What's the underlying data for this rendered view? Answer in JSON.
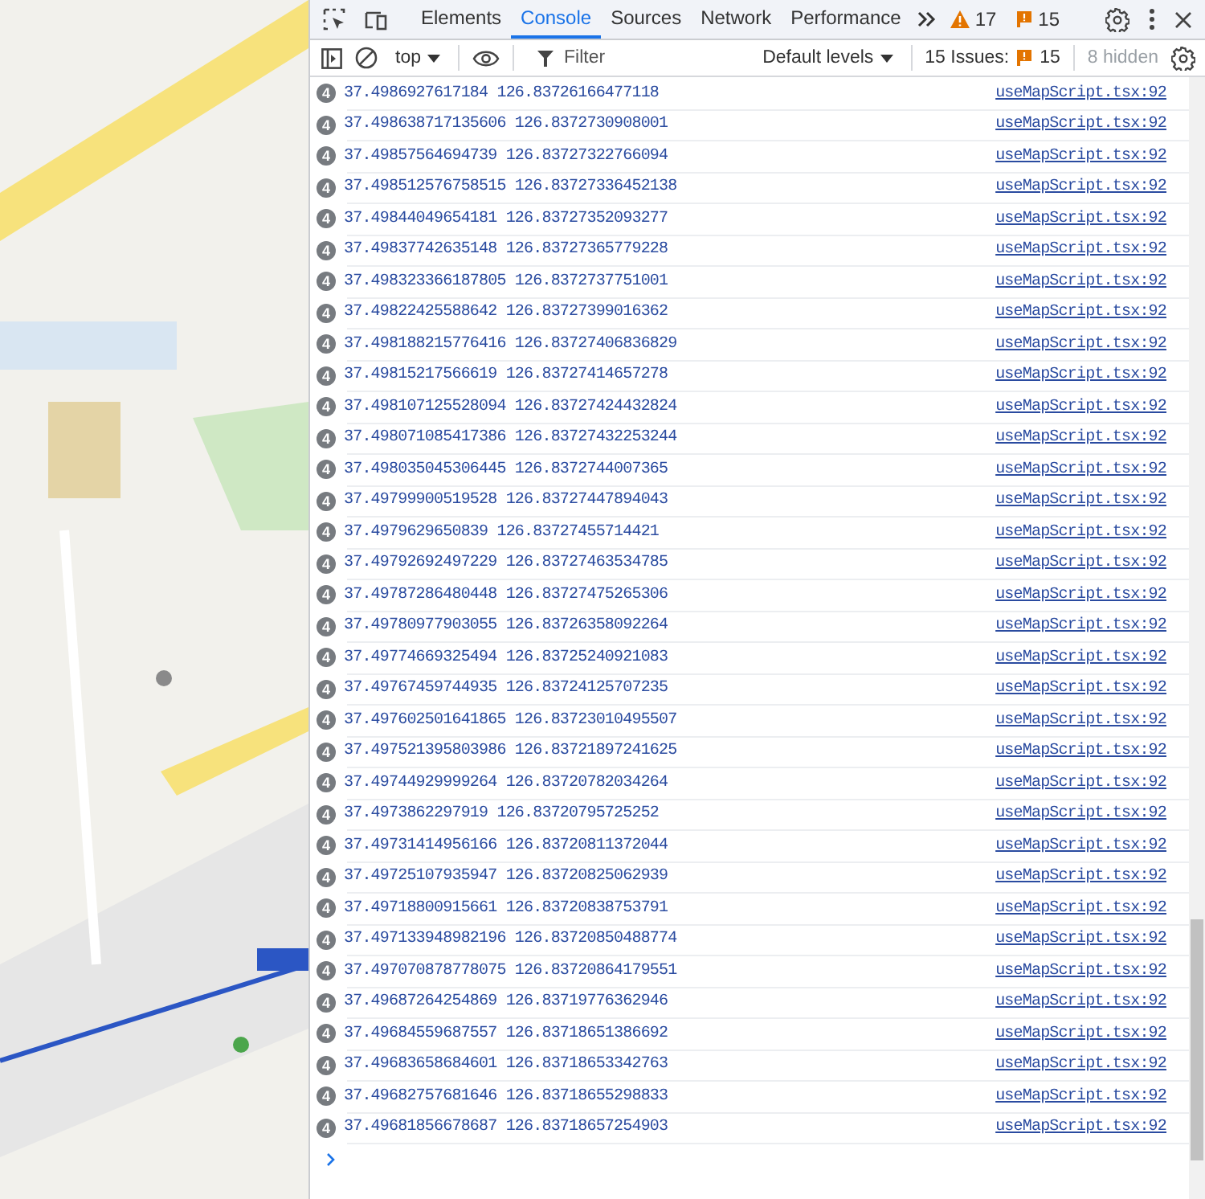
{
  "devtools": {
    "tabs": [
      {
        "label": "Elements",
        "selected": false
      },
      {
        "label": "Console",
        "selected": true
      },
      {
        "label": "Sources",
        "selected": false
      },
      {
        "label": "Network",
        "selected": false
      },
      {
        "label": "Performance",
        "selected": false
      }
    ],
    "warning_count": "17",
    "issue_count": "15",
    "toolbar": {
      "context": "top",
      "filter_placeholder": "Filter",
      "levels": "Default levels",
      "issues_label": "15 Issues:",
      "issues_count": "15",
      "hidden": "8 hidden"
    },
    "logs": [
      {
        "count": "4",
        "text": "37.4986927617184 126.83726166477118",
        "source": "useMapScript.tsx:92"
      },
      {
        "count": "4",
        "text": "37.498638717135606 126.8372730908001",
        "source": "useMapScript.tsx:92"
      },
      {
        "count": "4",
        "text": "37.49857564694739 126.83727322766094",
        "source": "useMapScript.tsx:92"
      },
      {
        "count": "4",
        "text": "37.498512576758515 126.83727336452138",
        "source": "useMapScript.tsx:92"
      },
      {
        "count": "4",
        "text": "37.49844049654181 126.83727352093277",
        "source": "useMapScript.tsx:92"
      },
      {
        "count": "4",
        "text": "37.49837742635148 126.83727365779228",
        "source": "useMapScript.tsx:92"
      },
      {
        "count": "4",
        "text": "37.498323366187805 126.8372737751001",
        "source": "useMapScript.tsx:92"
      },
      {
        "count": "4",
        "text": "37.49822425588642 126.83727399016362",
        "source": "useMapScript.tsx:92"
      },
      {
        "count": "4",
        "text": "37.498188215776416 126.83727406836829",
        "source": "useMapScript.tsx:92"
      },
      {
        "count": "4",
        "text": "37.49815217566619 126.83727414657278",
        "source": "useMapScript.tsx:92"
      },
      {
        "count": "4",
        "text": "37.498107125528094 126.83727424432824",
        "source": "useMapScript.tsx:92"
      },
      {
        "count": "4",
        "text": "37.498071085417386 126.83727432253244",
        "source": "useMapScript.tsx:92"
      },
      {
        "count": "4",
        "text": "37.498035045306445 126.8372744007365",
        "source": "useMapScript.tsx:92"
      },
      {
        "count": "4",
        "text": "37.49799900519528 126.83727447894043",
        "source": "useMapScript.tsx:92"
      },
      {
        "count": "4",
        "text": "37.4979629650839 126.83727455714421",
        "source": "useMapScript.tsx:92"
      },
      {
        "count": "4",
        "text": "37.49792692497229 126.83727463534785",
        "source": "useMapScript.tsx:92"
      },
      {
        "count": "4",
        "text": "37.49787286480448 126.83727475265306",
        "source": "useMapScript.tsx:92"
      },
      {
        "count": "4",
        "text": "37.49780977903055 126.83726358092264",
        "source": "useMapScript.tsx:92"
      },
      {
        "count": "4",
        "text": "37.49774669325494 126.83725240921083",
        "source": "useMapScript.tsx:92"
      },
      {
        "count": "4",
        "text": "37.49767459744935 126.83724125707235",
        "source": "useMapScript.tsx:92"
      },
      {
        "count": "4",
        "text": "37.497602501641865 126.83723010495507",
        "source": "useMapScript.tsx:92"
      },
      {
        "count": "4",
        "text": "37.497521395803986 126.83721897241625",
        "source": "useMapScript.tsx:92"
      },
      {
        "count": "4",
        "text": "37.49744929999264 126.83720782034264",
        "source": "useMapScript.tsx:92"
      },
      {
        "count": "4",
        "text": "37.4973862297919 126.83720795725252",
        "source": "useMapScript.tsx:92"
      },
      {
        "count": "4",
        "text": "37.49731414956166 126.83720811372044",
        "source": "useMapScript.tsx:92"
      },
      {
        "count": "4",
        "text": "37.49725107935947 126.83720825062939",
        "source": "useMapScript.tsx:92"
      },
      {
        "count": "4",
        "text": "37.49718800915661 126.83720838753791",
        "source": "useMapScript.tsx:92"
      },
      {
        "count": "4",
        "text": "37.497133948982196 126.83720850488774",
        "source": "useMapScript.tsx:92"
      },
      {
        "count": "4",
        "text": "37.497070878778075 126.83720864179551",
        "source": "useMapScript.tsx:92"
      },
      {
        "count": "4",
        "text": "37.49687264254869 126.83719776362946",
        "source": "useMapScript.tsx:92"
      },
      {
        "count": "4",
        "text": "37.49684559687557 126.83718651386692",
        "source": "useMapScript.tsx:92"
      },
      {
        "count": "4",
        "text": "37.49683658684601 126.83718653342763",
        "source": "useMapScript.tsx:92"
      },
      {
        "count": "4",
        "text": "37.49682757681646 126.83718655298833",
        "source": "useMapScript.tsx:92"
      },
      {
        "count": "4",
        "text": "37.49681856678687 126.83718657254903",
        "source": "useMapScript.tsx:92"
      }
    ]
  }
}
